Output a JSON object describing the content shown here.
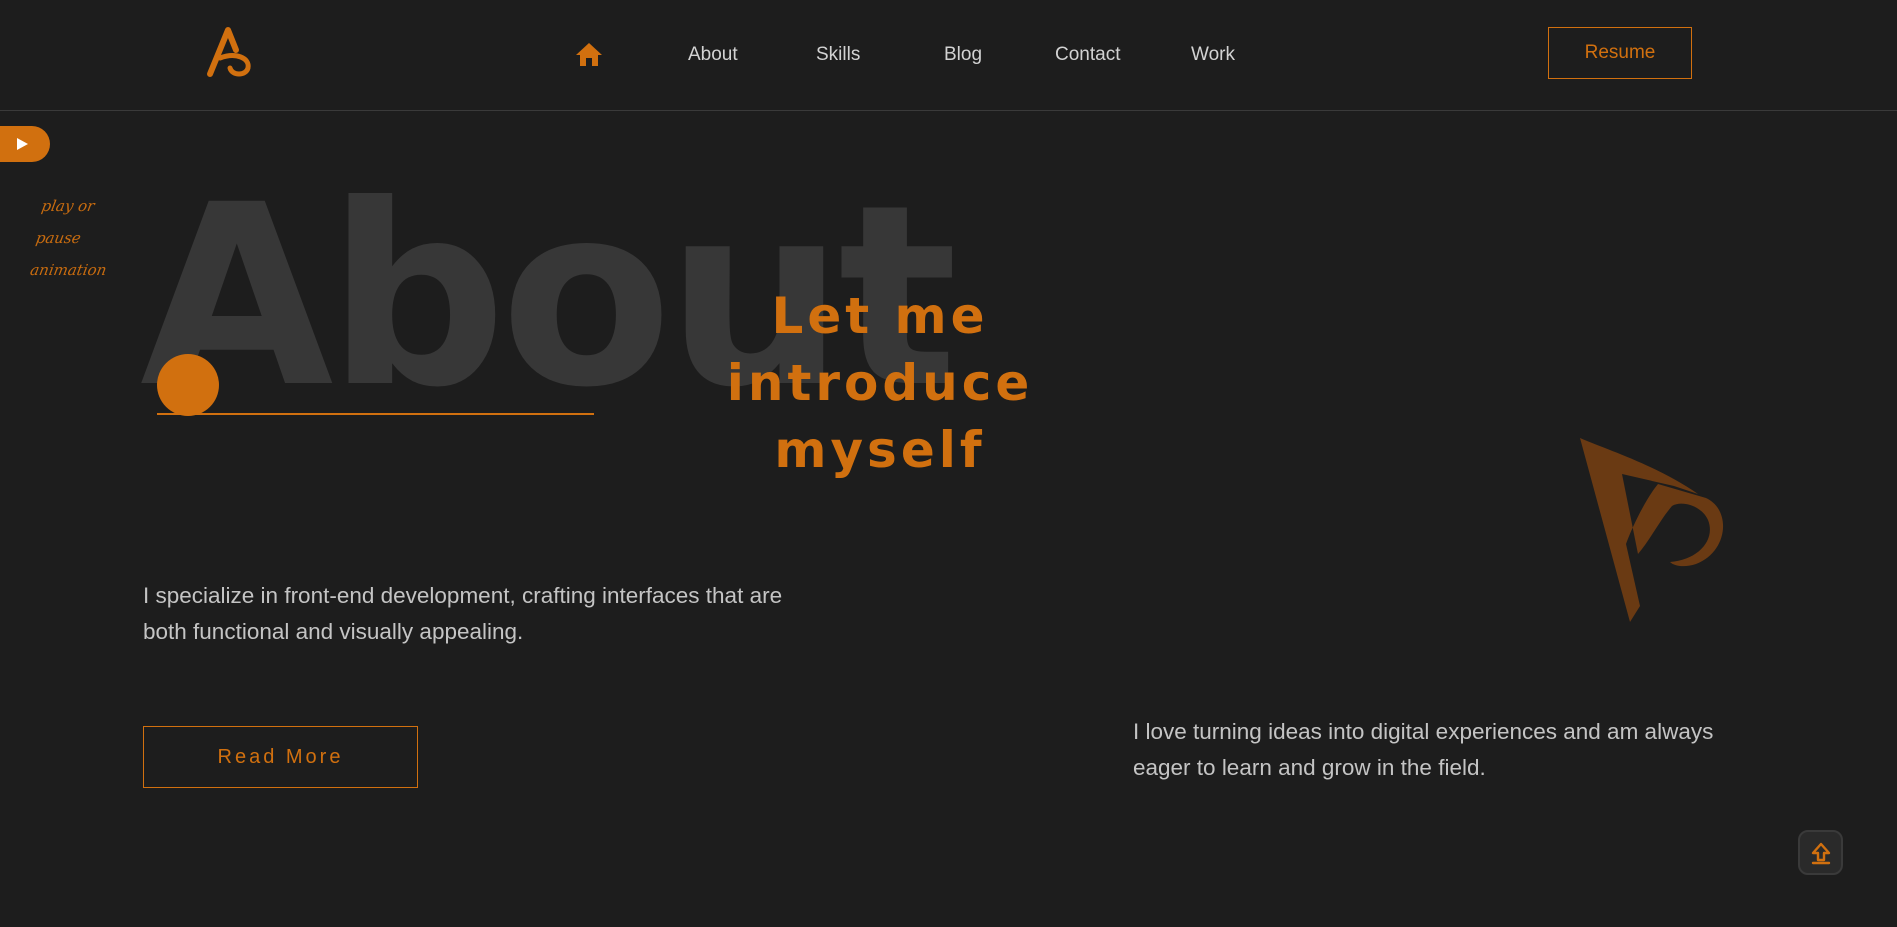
{
  "header": {
    "logo_icon": "stylized-a-logo-icon",
    "home_icon": "home-icon",
    "nav": [
      "About",
      "Skills",
      "Blog",
      "Contact",
      "Work"
    ],
    "resume_label": "Resume"
  },
  "animation_toggle": {
    "icon": "play-icon",
    "caption": "play or pause animation"
  },
  "hero": {
    "background_word": "About",
    "title": "Let me introduce myself",
    "paragraph_left": "I specialize in front-end development, crafting interfaces that are both functional and visually appealing.",
    "read_more_label": "Read More",
    "paragraph_right": "I love turning ideas into digital experiences and am always eager to learn and grow in the field.",
    "decor_icon": "large-logo-icon"
  },
  "scroll_top": {
    "icon": "arrow-up-icon"
  },
  "colors": {
    "background": "#1d1d1d",
    "accent": "#d1700f",
    "text": "#c4c4c4",
    "bg_word": "#373737"
  }
}
